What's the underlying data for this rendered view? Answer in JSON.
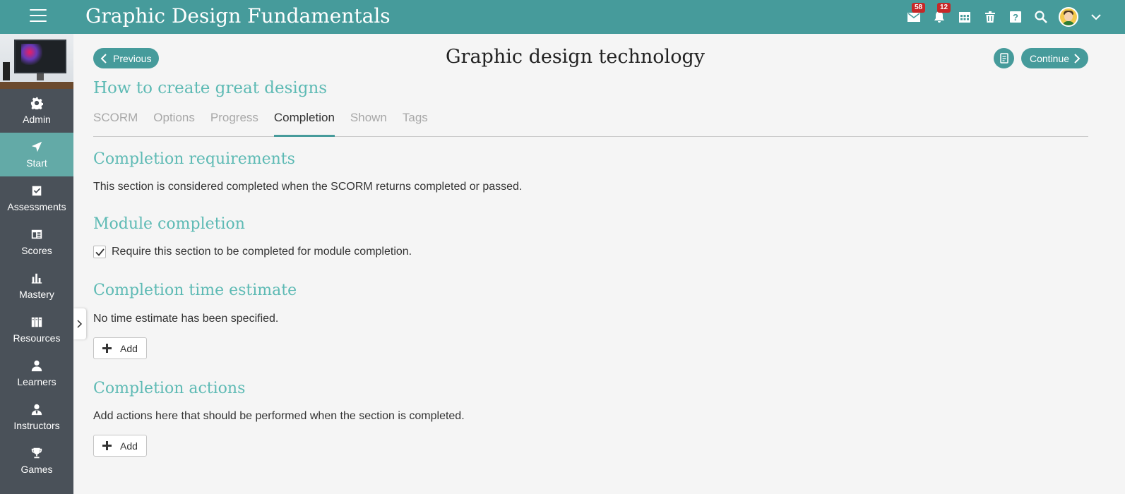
{
  "header": {
    "title": "Graphic Design Fundamentals",
    "messages_badge": "58",
    "notifications_badge": "12"
  },
  "sidebar": {
    "items": [
      {
        "label": "Admin",
        "icon": "gear-icon"
      },
      {
        "label": "Start",
        "icon": "navigation-arrow-icon"
      },
      {
        "label": "Assessments",
        "icon": "checklist-icon"
      },
      {
        "label": "Scores",
        "icon": "gradebook-icon"
      },
      {
        "label": "Mastery",
        "icon": "bar-chart-icon"
      },
      {
        "label": "Resources",
        "icon": "books-icon"
      },
      {
        "label": "Learners",
        "icon": "person-icon"
      },
      {
        "label": "Instructors",
        "icon": "instructor-icon"
      },
      {
        "label": "Games",
        "icon": "trophy-icon"
      }
    ],
    "active": "Start"
  },
  "nav": {
    "previous_label": "Previous",
    "continue_label": "Continue"
  },
  "page": {
    "title": "Graphic design technology",
    "section_title": "How to create great designs"
  },
  "tabs": [
    "SCORM",
    "Options",
    "Progress",
    "Completion",
    "Shown",
    "Tags"
  ],
  "active_tab": "Completion",
  "completion": {
    "requirements_heading": "Completion requirements",
    "requirements_text": "This section is considered completed when the SCORM returns completed or passed.",
    "module_heading": "Module completion",
    "module_checkbox_label": "Require this section to be completed for module completion.",
    "module_checkbox_checked": true,
    "time_heading": "Completion time estimate",
    "time_text": "No time estimate has been specified.",
    "add_label": "Add",
    "actions_heading": "Completion actions",
    "actions_text": "Add actions here that should be performed when the section is completed."
  },
  "colors": {
    "header_bg": "#469b9b",
    "sidebar_bg": "#4a5159",
    "sidebar_active": "#63aaa7",
    "heading_teal": "#5dbab4",
    "badge_red": "#c62828"
  }
}
